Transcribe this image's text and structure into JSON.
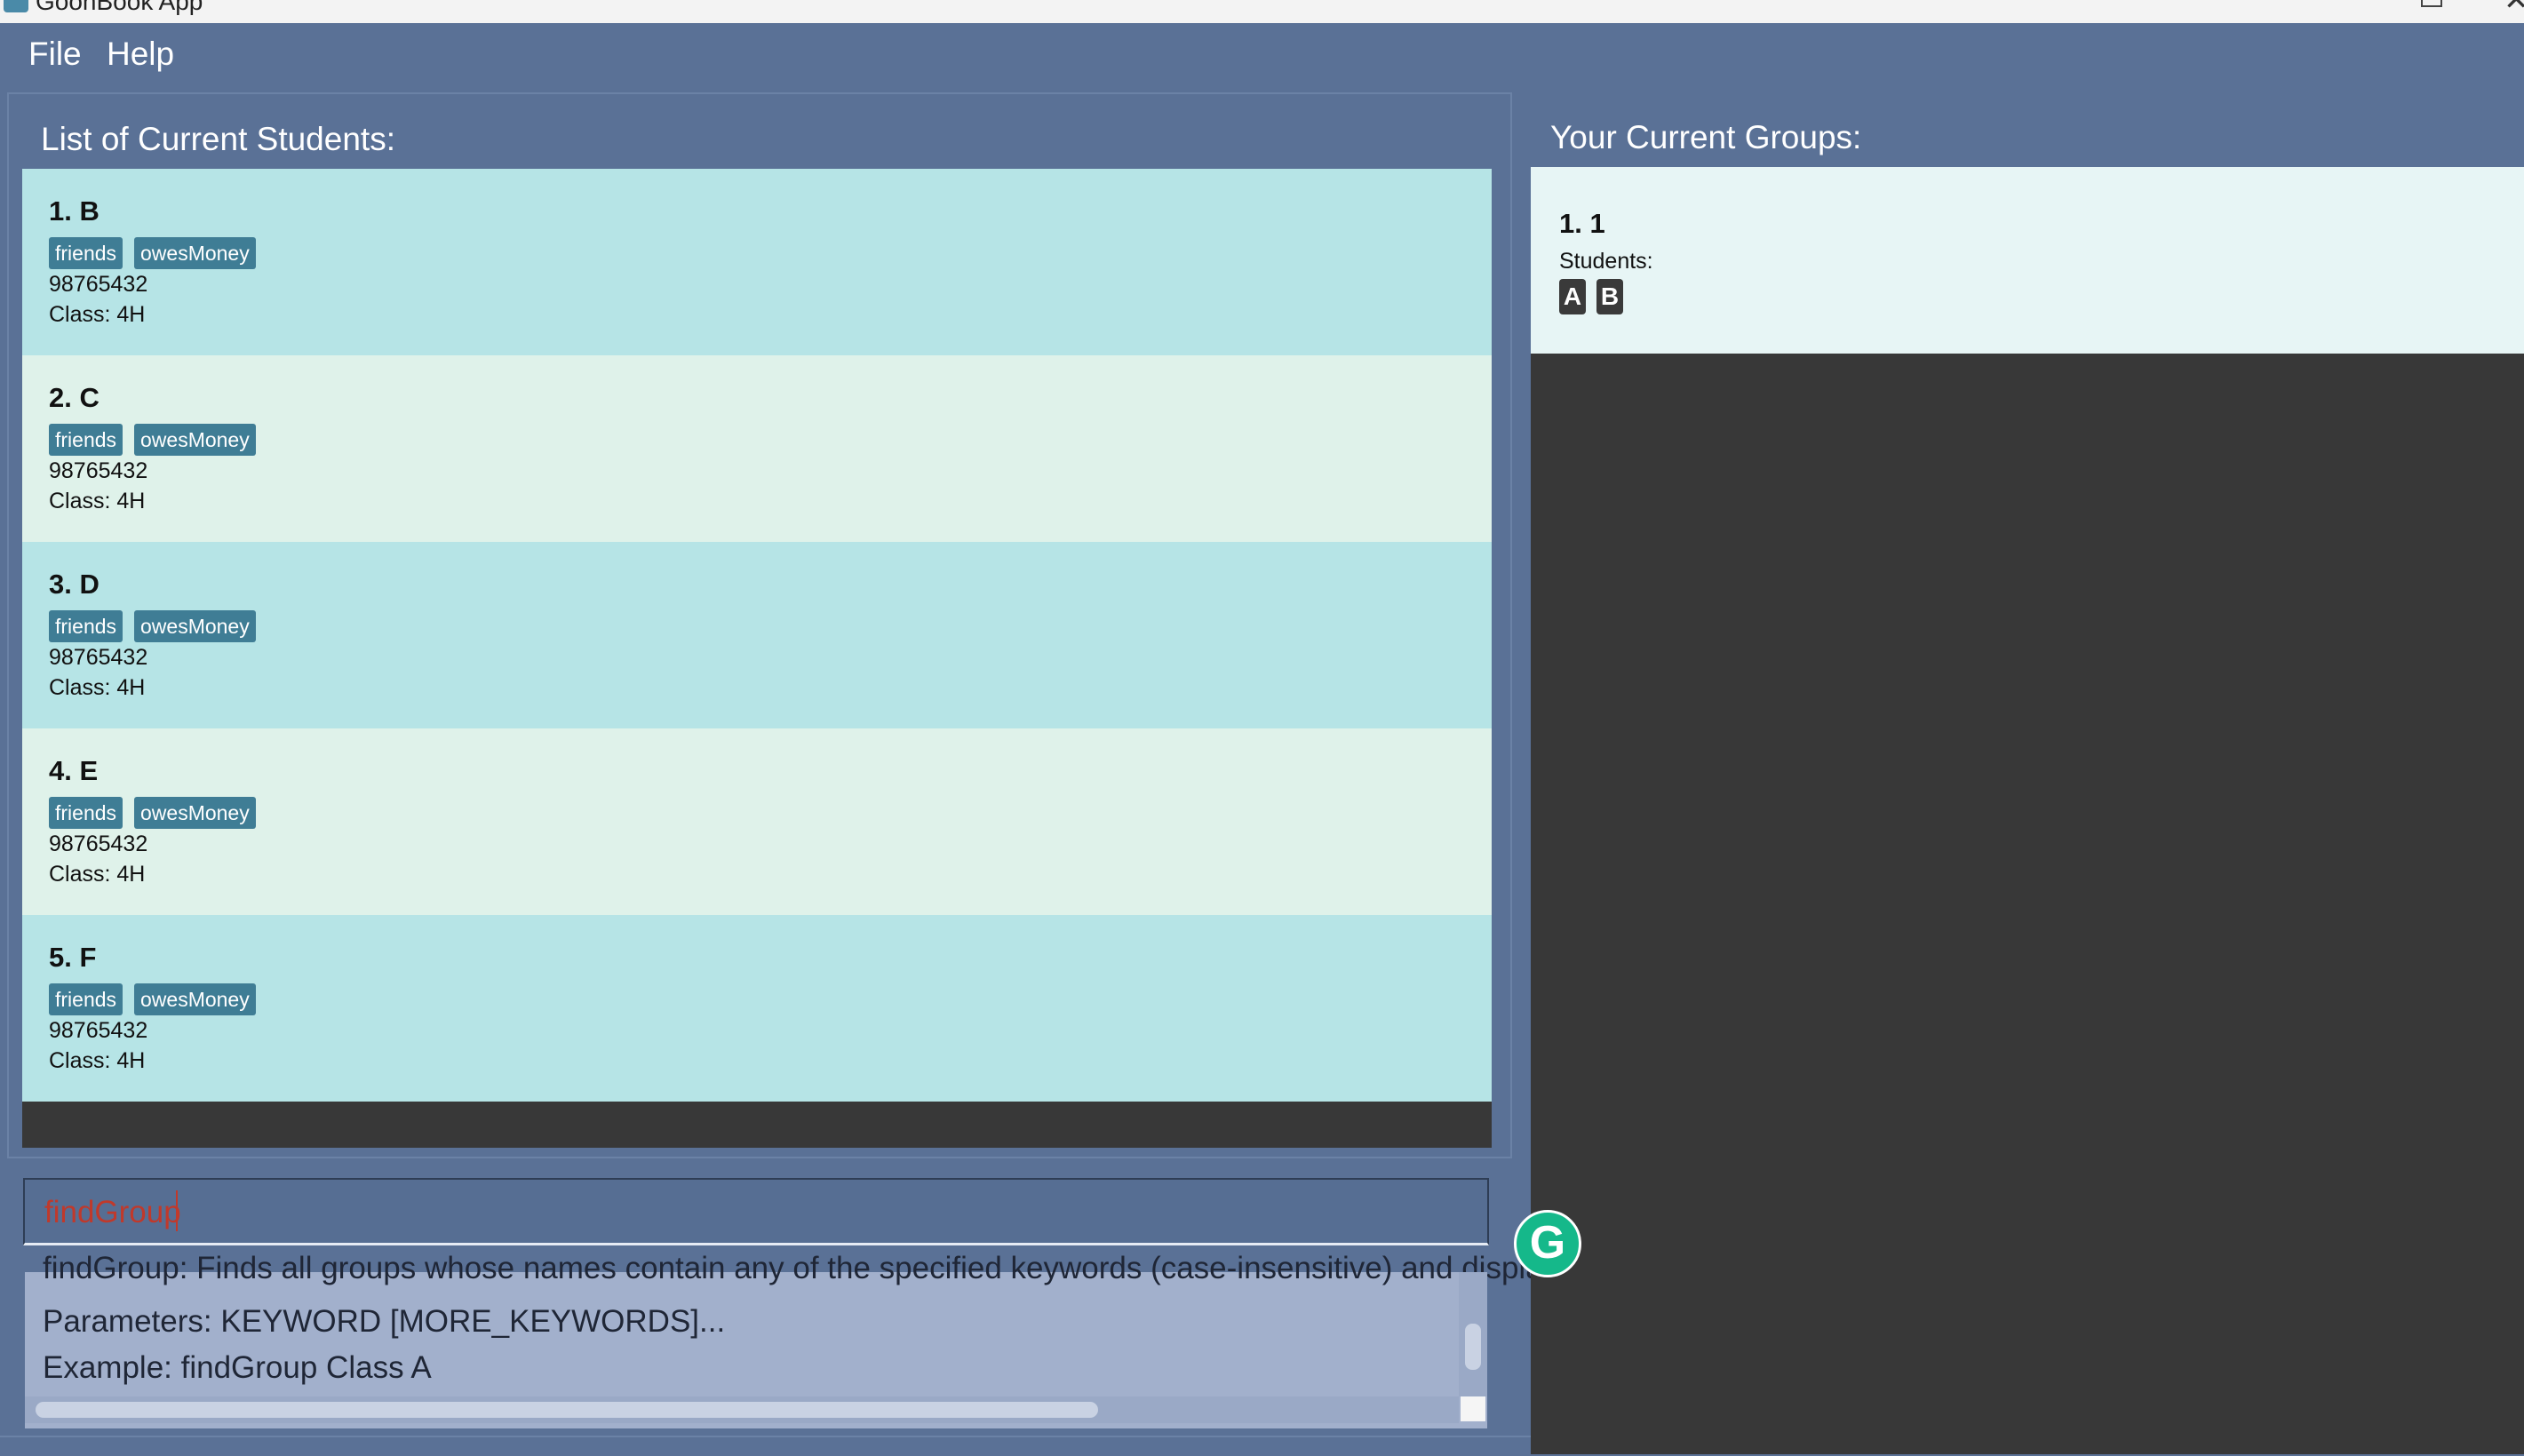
{
  "window": {
    "title": "GoonBook App"
  },
  "menu": {
    "file": "File",
    "help": "Help"
  },
  "students_panel": {
    "title": "List of Current Students:",
    "students": [
      {
        "name": "1. B",
        "tags": [
          "friends",
          "owesMoney"
        ],
        "phone": "98765432",
        "class": "Class: 4H"
      },
      {
        "name": "2. C",
        "tags": [
          "friends",
          "owesMoney"
        ],
        "phone": "98765432",
        "class": "Class: 4H"
      },
      {
        "name": "3. D",
        "tags": [
          "friends",
          "owesMoney"
        ],
        "phone": "98765432",
        "class": "Class: 4H"
      },
      {
        "name": "4. E",
        "tags": [
          "friends",
          "owesMoney"
        ],
        "phone": "98765432",
        "class": "Class: 4H"
      },
      {
        "name": "5. F",
        "tags": [
          "friends",
          "owesMoney"
        ],
        "phone": "98765432",
        "class": "Class: 4H"
      }
    ]
  },
  "command": {
    "value": "findGroup"
  },
  "result": {
    "partial_line": "findGroup: Finds all groups whose names contain any of the specified keywords (case-insensitive) and displays them",
    "line1": "Parameters: KEYWORD [MORE_KEYWORDS]...",
    "line2": "Example: findGroup Class A"
  },
  "groups_panel": {
    "title": "Your Current Groups:",
    "groups": [
      {
        "name": "1. 1",
        "students_label": "Students:",
        "members": [
          "A",
          "B"
        ]
      }
    ]
  },
  "colors": {
    "background": "#5a7196",
    "card_odd": "#b6e4e6",
    "card_even": "#dff2ea",
    "tag": "#3f7d95",
    "command_text": "#c0392b"
  },
  "icons": {
    "grammarly": "G"
  }
}
